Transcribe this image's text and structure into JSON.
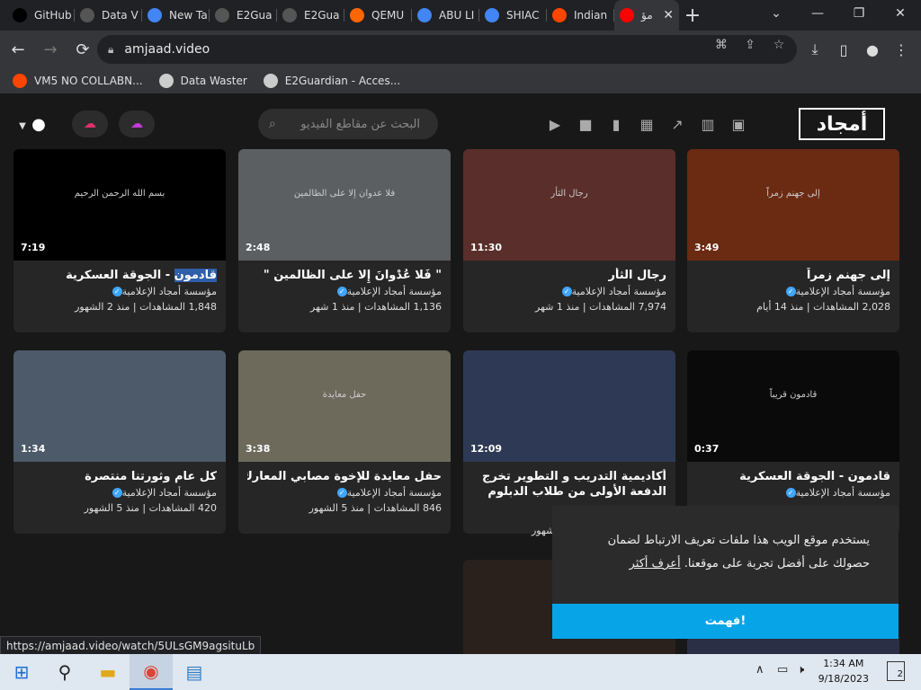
{
  "browser": {
    "tabs": [
      {
        "label": "GitHub",
        "icon": "github-icon",
        "color": "#000000"
      },
      {
        "label": "Data V",
        "icon": "globe-icon",
        "color": "#555555"
      },
      {
        "label": "New Ta",
        "icon": "chrome-icon",
        "color": "#4285f4"
      },
      {
        "label": "E2Gua",
        "icon": "globe-icon",
        "color": "#555555"
      },
      {
        "label": "E2Gua",
        "icon": "globe-icon",
        "color": "#555555"
      },
      {
        "label": "QEMU",
        "icon": "qemu-icon",
        "color": "#ff6600"
      },
      {
        "label": "ABU LI",
        "icon": "google-icon",
        "color": "#4285f4"
      },
      {
        "label": "SHIAC",
        "icon": "google-icon",
        "color": "#4285f4"
      },
      {
        "label": "Indian",
        "icon": "reddit-icon",
        "color": "#ff4500"
      },
      {
        "label": "مؤ",
        "icon": "youtube-icon",
        "color": "#ff0000",
        "active": true
      }
    ],
    "url": "amjaad.video",
    "bookmarks": [
      {
        "label": "VM5 NO COLLABN...",
        "icon": "reddit-icon",
        "color": "#ff4500"
      },
      {
        "label": "Data Waster",
        "icon": "globe-icon",
        "color": "#cccccc"
      },
      {
        "label": "E2Guardian - Acces...",
        "icon": "globe-icon",
        "color": "#cccccc"
      }
    ],
    "status_url": "https://amjaad.video/watch/5ULsGM9agsituLb"
  },
  "site": {
    "logo_text": "أمجاد",
    "search_placeholder": "البحث عن مقاطع الفيديو",
    "accent_upload": "#e0306b",
    "accent_live": "#c23cd6",
    "videos": [
      {
        "title": "إلى جهنم زمراً",
        "channel": "مؤسسة أمجاد الإعلامية",
        "stats": "2,028 المشاهدات | منذ 14 أيام",
        "duration": "3:49",
        "thumb_color": "#6b2a12",
        "caption": "إلى جهنم زمراً"
      },
      {
        "title": "رجال الثأر",
        "channel": "مؤسسة أمجاد الإعلامية",
        "stats": "7,974 المشاهدات | منذ 1 شهر",
        "duration": "11:30",
        "thumb_color": "#5a2e2a",
        "caption": "رجال الثأر"
      },
      {
        "title": "\" فَلا عُدْوانَ إِلا على الظالمين \"",
        "channel": "مؤسسة أمجاد الإعلامية",
        "stats": "1,136 المشاهدات | منذ 1 شهر",
        "duration": "2:48",
        "thumb_color": "#5b5f62",
        "caption": "فلا عدوان إلا على الظالمين"
      },
      {
        "title_prefix": "قادمون",
        "title": " - الجوقة العسكرية",
        "channel": "مؤسسة أمجاد الإعلامية",
        "stats": "1,848 المشاهدات | منذ 2 الشهور",
        "duration": "7:19",
        "thumb_color": "#000000",
        "caption": "بسم الله الرحمن الرحيم"
      },
      {
        "title": "قادمون - الجوقة العسكرية",
        "channel": "مؤسسة أمجاد الإعلامية",
        "stats": "",
        "duration": "0:37",
        "thumb_color": "#0a0a0a",
        "caption": "قادمون قريباً"
      },
      {
        "title": "أكاديمية التدريب و التطوير تخرج الدفعة الأولى من طلاب الدبلوم المهني",
        "channel": "",
        "stats": "",
        "duration": "12:09",
        "thumb_color": "#2e3a55",
        "caption": ""
      },
      {
        "title": "حفل معايدة للإخوة مصابي المعارك",
        "channel": "مؤسسة أمجاد الإعلامية",
        "stats": "846 المشاهدات | منذ 5 الشهور",
        "duration": "3:38",
        "thumb_color": "#6d6a5c",
        "caption": "حفل معايدة"
      },
      {
        "title": "كل عام وثورتنا منتصرة",
        "channel": "مؤسسة أمجاد الإعلامية",
        "stats": "420 المشاهدات | منذ 5 الشهور",
        "duration": "1:34",
        "thumb_color": "#4d5a6a",
        "caption": ""
      }
    ],
    "partial_stats": "شهور",
    "cookie": {
      "text": "يستخدم موقع الويب هذا ملفات تعريف الارتباط لضمان حصولك على أفضل تجربة على موقعنا.",
      "more": "أعرف أكثر",
      "button": "فهمت!"
    }
  },
  "taskbar": {
    "time": "1:34 AM",
    "date": "9/18/2023",
    "notifications": "2"
  }
}
